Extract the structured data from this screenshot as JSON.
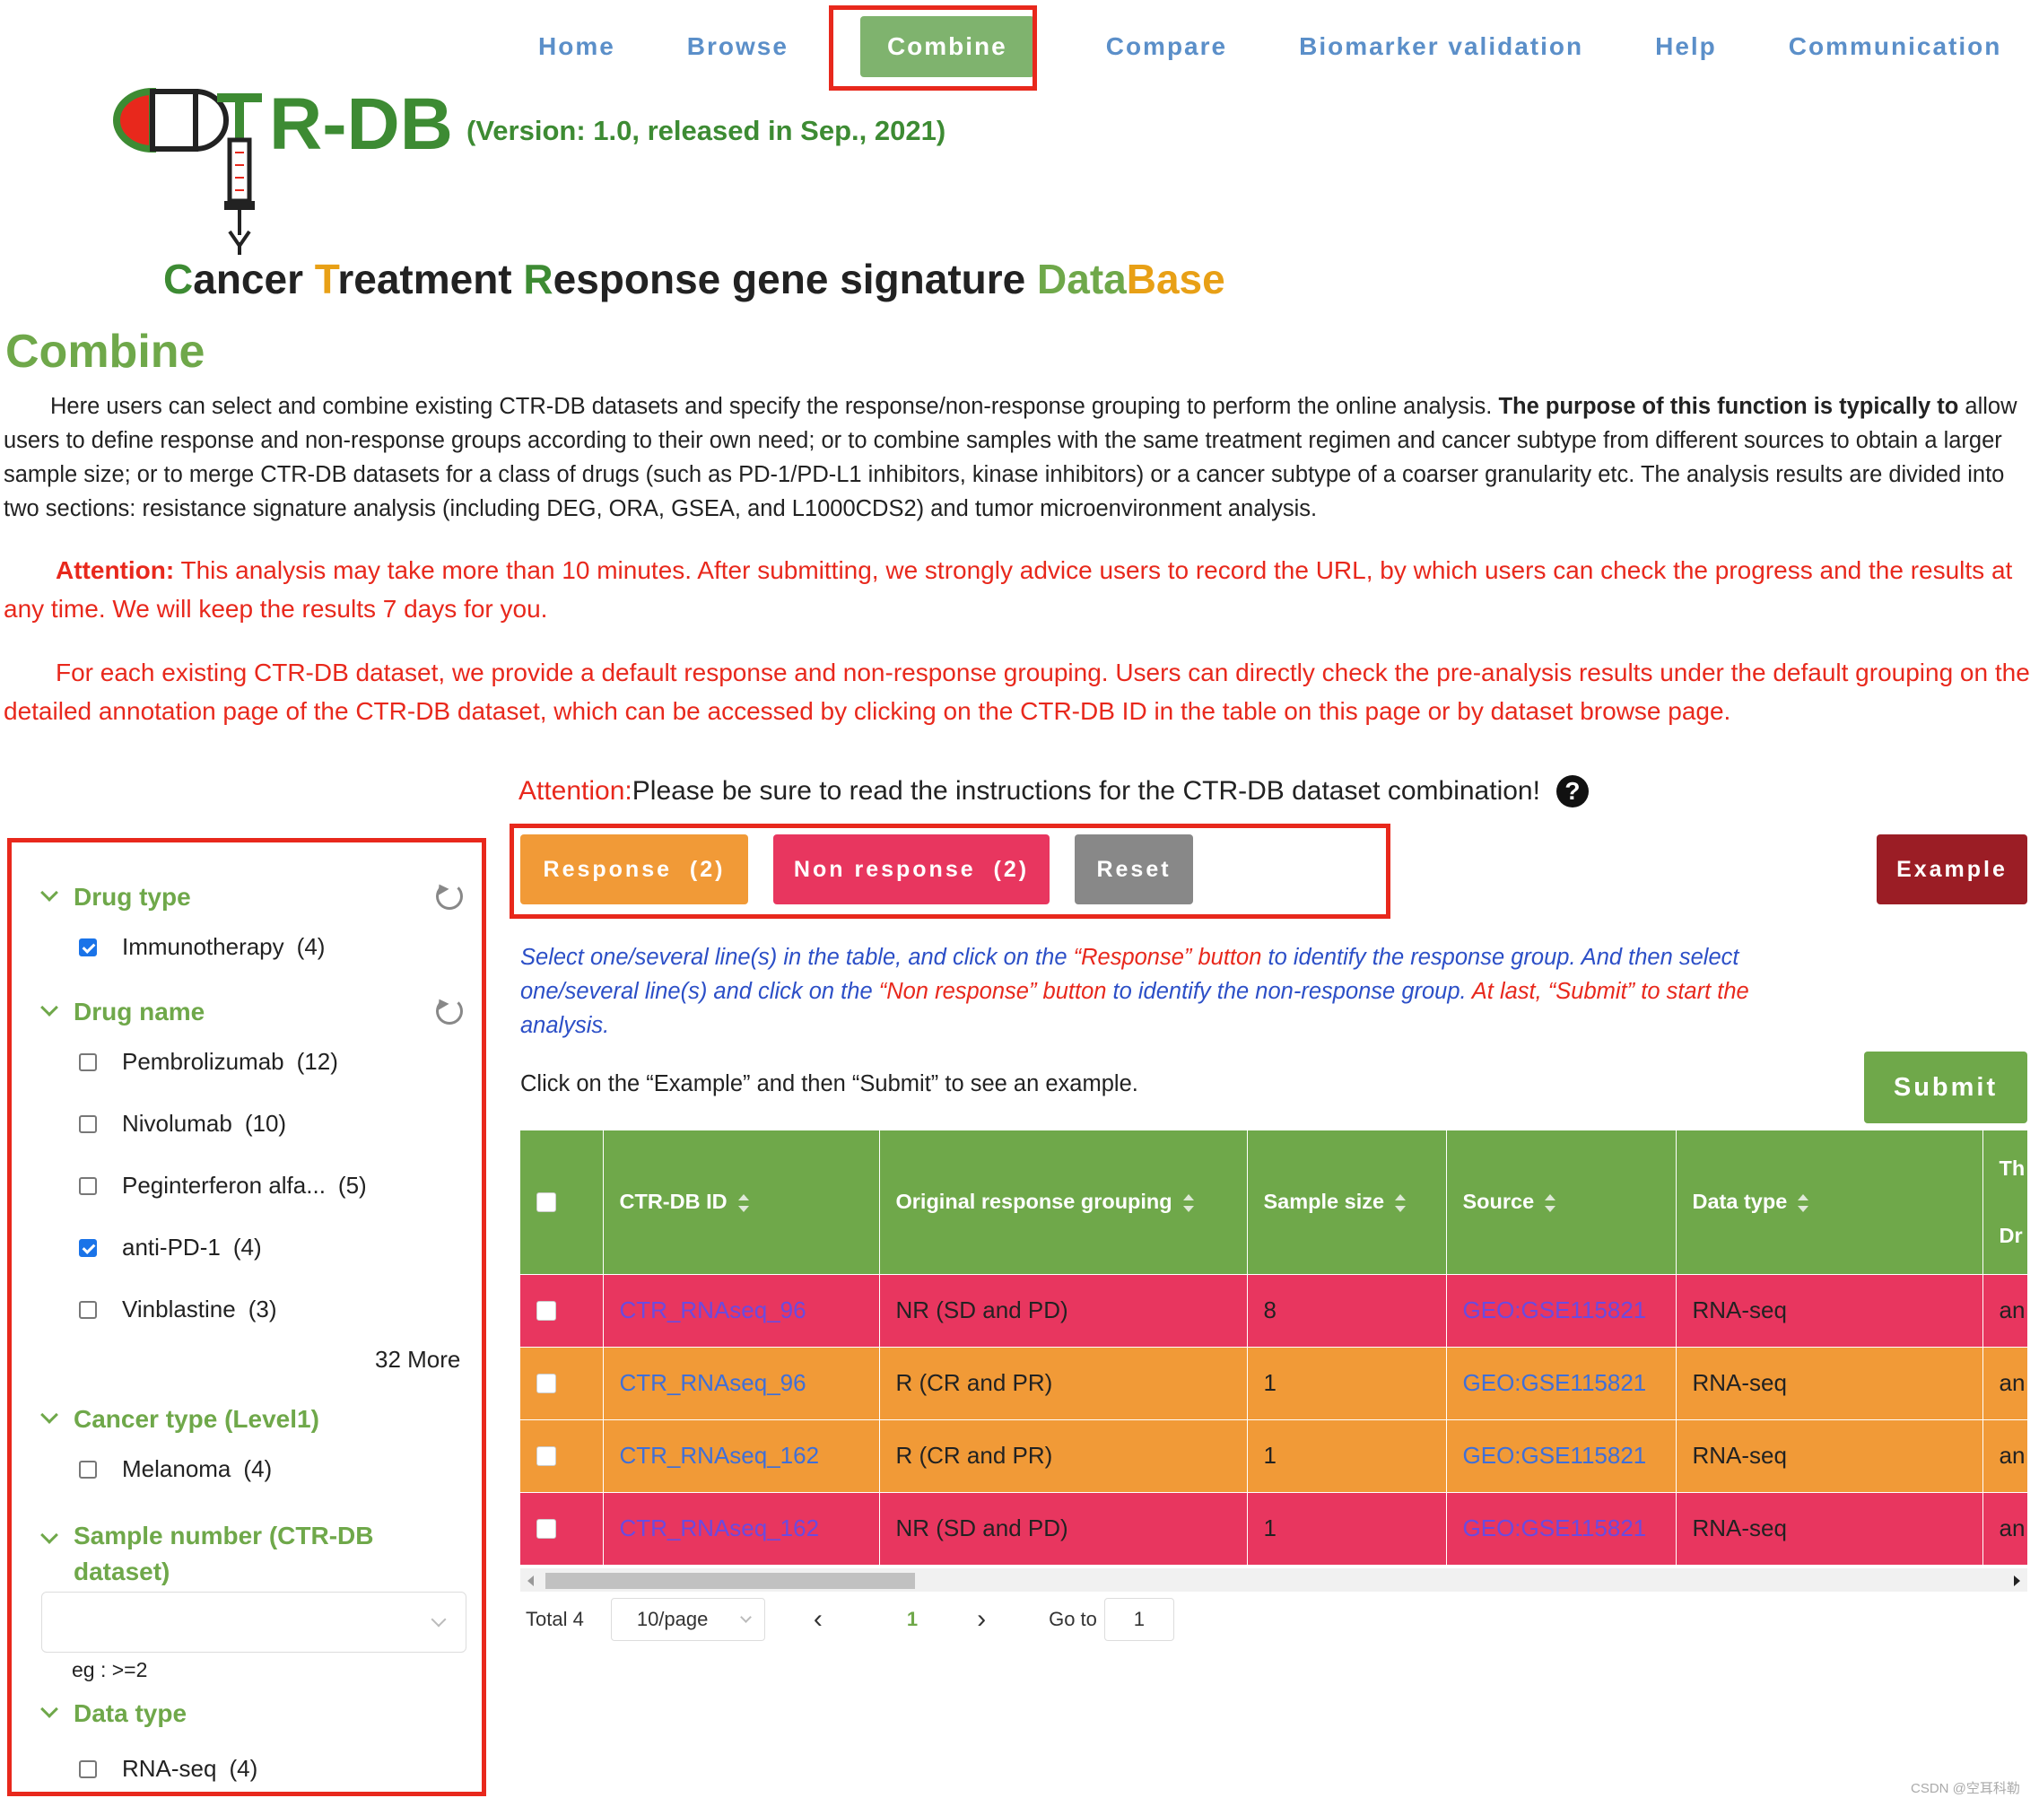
{
  "nav": {
    "items": [
      "Home",
      "Browse",
      "Combine",
      "Compare",
      "Biomarker validation",
      "Help",
      "Communication"
    ],
    "active": "Combine"
  },
  "brand": {
    "logo_text": "R-DB",
    "version": "(Version: 1.0, released in Sep., 2021)",
    "subtitle": {
      "c1": "C",
      "w1": "ancer ",
      "c2": "T",
      "w2": "reatment ",
      "c3": "R",
      "w3": "esponse gene signature ",
      "c4": "Data",
      "c5": "Base"
    }
  },
  "page_title": "Combine",
  "intro": {
    "text1": "Here users can select and combine existing CTR-DB datasets and specify the response/non-response grouping to perform the online analysis. ",
    "bold": "The purpose of this function is typically to",
    "text2": " allow users to define response and non-response groups according to their own need; or to combine samples with the same treatment regimen and cancer subtype from different sources to obtain a larger sample size; or to merge CTR-DB datasets for a class of drugs (such as PD-1/PD-L1 inhibitors, kinase inhibitors) or a cancer subtype of a coarser granularity etc. The analysis results are divided into two sections: resistance signature analysis (including DEG, ORA, GSEA, and L1000CDS2) and tumor microenvironment analysis."
  },
  "attention1": {
    "label": "Attention:",
    "text": " This analysis may take more than 10 minutes. After submitting, we strongly advice users to record the URL, by which users can check the progress and the results at any time. We will keep the results 7 days for you."
  },
  "note": "For each existing CTR-DB dataset, we provide a default response and non-response grouping. Users can directly check the pre-analysis results under the default grouping on the detailed annotation page of the CTR-DB dataset, which can be accessed by clicking on the CTR-DB ID in the table on this page or by dataset browse page.",
  "attention2": {
    "label": "Attention:",
    "text": " Please be sure to read the instructions for the CTR-DB dataset combination!",
    "help_icon": "?"
  },
  "buttons": {
    "response": "Response  (2)",
    "non_response": "Non response  (2)",
    "reset": "Reset",
    "example": "Example",
    "submit": "Submit"
  },
  "instructions": {
    "p1": "Select one/several line(s) in the table, and click on the ",
    "q1": "“Response” button",
    "p2": " to identify the response group. And then select one/several line(s) and click on the ",
    "q2": "“Non response” button",
    "p3": " to identify the non-response group. ",
    "q3": "At last, “Submit” to start the",
    "p4": " analysis."
  },
  "click_example": "Click on the “Example” and then “Submit” to see an example.",
  "filters": {
    "drug_type": {
      "title": "Drug type",
      "options": [
        {
          "label": "Immunotherapy",
          "count": "(4)",
          "checked": true
        }
      ]
    },
    "drug_name": {
      "title": "Drug name",
      "options": [
        {
          "label": "Pembrolizumab",
          "count": "(12)",
          "checked": false
        },
        {
          "label": "Nivolumab",
          "count": "(10)",
          "checked": false
        },
        {
          "label": "Peginterferon alfa...",
          "count": "(5)",
          "checked": false
        },
        {
          "label": "anti-PD-1",
          "count": "(4)",
          "checked": true
        },
        {
          "label": "Vinblastine",
          "count": "(3)",
          "checked": false
        }
      ],
      "more": "32 More"
    },
    "cancer_type": {
      "title": "Cancer type (Level1)",
      "options": [
        {
          "label": "Melanoma",
          "count": "(4)",
          "checked": false
        }
      ]
    },
    "sample_number": {
      "title": "Sample number (CTR-DB dataset)",
      "hint": "eg : >=2"
    },
    "data_type": {
      "title": "Data type",
      "options": [
        {
          "label": "RNA-seq",
          "count": "(4)",
          "checked": false
        }
      ]
    }
  },
  "table": {
    "headers": [
      "CTR-DB ID",
      "Original response grouping",
      "Sample size",
      "Source",
      "Data type",
      "Th",
      "Dr"
    ],
    "rows": [
      {
        "id": "CTR_RNAseq_96",
        "grouping": "NR (SD and PD)",
        "size": "8",
        "source": "GEO:GSE115821",
        "dtype": "RNA-seq",
        "extra": "an",
        "group": "nr"
      },
      {
        "id": "CTR_RNAseq_96",
        "grouping": "R (CR and PR)",
        "size": "1",
        "source": "GEO:GSE115821",
        "dtype": "RNA-seq",
        "extra": "an",
        "group": "r"
      },
      {
        "id": "CTR_RNAseq_162",
        "grouping": "R (CR and PR)",
        "size": "1",
        "source": "GEO:GSE115821",
        "dtype": "RNA-seq",
        "extra": "an",
        "group": "r"
      },
      {
        "id": "CTR_RNAseq_162",
        "grouping": "NR (SD and PD)",
        "size": "1",
        "source": "GEO:GSE115821",
        "dtype": "RNA-seq",
        "extra": "an",
        "group": "nr"
      }
    ]
  },
  "pagination": {
    "total": "Total 4",
    "page_size": "10/page",
    "prev": "‹",
    "current": "1",
    "next": "›",
    "goto_label": "Go to",
    "goto_value": "1"
  },
  "watermark": "CSDN @空耳科勒",
  "colors": {
    "green": "#6fa84a",
    "dark_green": "#3d8b33",
    "orange": "#f19a37",
    "pink": "#e8365f",
    "red": "#e8281c",
    "maroon": "#9b1d25",
    "nav_blue": "#5b8fc9"
  }
}
